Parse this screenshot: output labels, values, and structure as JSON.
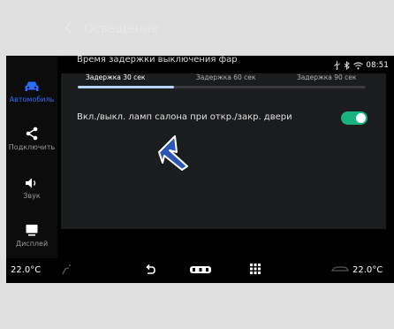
{
  "status": {
    "time": "08:51"
  },
  "sidebar": {
    "items": [
      {
        "label": "Автомобиль",
        "icon": "car-icon",
        "active": true
      },
      {
        "label": "Подключить",
        "icon": "share-icon",
        "active": false
      },
      {
        "label": "Звук",
        "icon": "speaker-icon",
        "active": false
      },
      {
        "label": "Дисплей",
        "icon": "display-icon",
        "active": false
      }
    ]
  },
  "header": {
    "title": "Освещение"
  },
  "delay_setting": {
    "label": "Время задержки выключения фар",
    "options": [
      "Задержка 30 сек",
      "Задержка 60 сек",
      "Задержка 90 сек"
    ],
    "selected_index": 0
  },
  "dome_setting": {
    "label": "Вкл./выкл. ламп салона при откр./закр. двери",
    "enabled": true
  },
  "bottom_bar": {
    "left_temp": "22.0°C",
    "right_temp": "22.0°C"
  },
  "colors": {
    "accent": "#2c6cff",
    "toggle_on": "#18b27f",
    "selected_track": "#b9d3ff",
    "cursor": "#2b56b8"
  }
}
